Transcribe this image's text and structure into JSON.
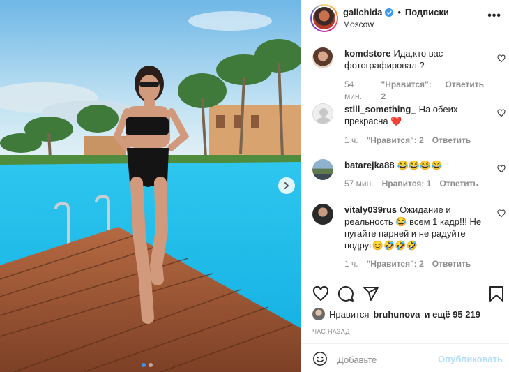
{
  "post": {
    "username": "galichida",
    "verified": true,
    "bullet": "•",
    "follow_label": "Подписки",
    "location": "Moscow",
    "more_label": "•••"
  },
  "comments": [
    {
      "username": "komdstore",
      "text": "Ида,кто вас фотографировал ?",
      "time": "54 мин.",
      "likes": "\"Нравится\": 2",
      "reply": "Ответить",
      "avatar_color": "#6b4a3a"
    },
    {
      "username": "still_something_",
      "text": "На обеих прекрасна ❤️",
      "time": "1 ч.",
      "likes": "\"Нравится\": 2",
      "reply": "Ответить",
      "avatar_color": "#dbdbdb"
    },
    {
      "username": "batarejka88",
      "text": "😂😂😂😂",
      "time": "57 мин.",
      "likes": "Нравится: 1",
      "reply": "Ответить",
      "avatar_color": "#4a6b8a"
    },
    {
      "username": "vitaly039rus",
      "text": "Ожидание и реальность 😂 всем 1 кадр!!! Не пугайте парней и не радуйте подруг😊🤣🤣🤣",
      "time": "1 ч.",
      "likes": "\"Нравится\": 2",
      "reply": "Ответить",
      "avatar_color": "#3a3a3a"
    }
  ],
  "actions": {
    "icons": [
      "heart-icon",
      "comment-icon",
      "share-icon",
      "bookmark-icon"
    ],
    "liked_prefix": "Нравится",
    "liked_user": "bruhunova",
    "liked_suffix": "и ещё 95 219",
    "time_ago": "ЧАС НАЗАД"
  },
  "add_comment": {
    "placeholder": "Добавьте",
    "publish_label": "Опубликовать"
  },
  "carousel": {
    "slides": 2,
    "active_slide": 1
  },
  "colors": {
    "text": "#262626",
    "muted": "#8e8e8e",
    "publish_disabled": "#b2dffc",
    "verified": "#3897f0",
    "heart_red": "#ed4956"
  }
}
